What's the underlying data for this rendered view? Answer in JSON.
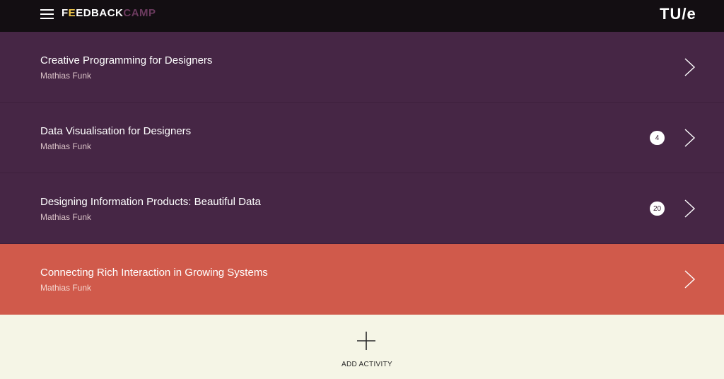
{
  "header": {
    "brand_first": "F",
    "brand_highlight": "E",
    "brand_rest": "EDBACK",
    "brand_suffix": "CAMP",
    "logo": "TU/e",
    "menu_icon": "hamburger-icon",
    "colors": {
      "background": "#130e12",
      "highlight": "#f2c94c",
      "suffix": "#6b3a5e"
    }
  },
  "activities": [
    {
      "title": "Creative Programming for Designers",
      "author": "Mathias Funk",
      "badge": null
    },
    {
      "title": "Data Visualisation for Designers",
      "author": "Mathias Funk",
      "badge": "4"
    },
    {
      "title": "Designing Information Products: Beautiful Data",
      "author": "Mathias Funk",
      "badge": "20"
    },
    {
      "title": "Connecting Rich Interaction in Growing Systems",
      "author": "Mathias Funk",
      "badge": null,
      "active": true
    }
  ],
  "add_activity": {
    "label": "ADD ACTIVITY",
    "icon": "plus-icon"
  },
  "colors": {
    "row": "#462645",
    "active_row": "#d05a4b",
    "footer": "#f5f5e6"
  }
}
